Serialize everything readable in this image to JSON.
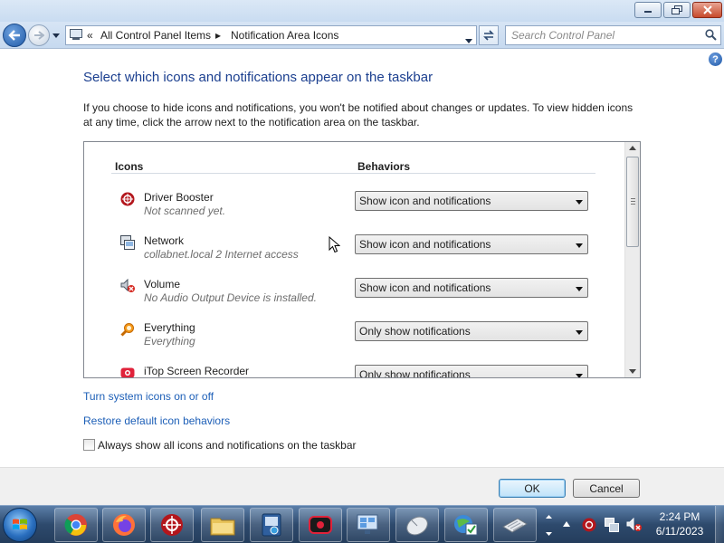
{
  "window": {
    "controls": {
      "minimize_icon": "minimize-icon",
      "maximize_icon": "maximize-icon",
      "close_icon": "close-icon"
    }
  },
  "address_bar": {
    "overflow_chevron": "«",
    "breadcrumbs": [
      "All Control Panel Items",
      "Notification Area Icons"
    ],
    "separator": "▸",
    "search_placeholder": "Search Control Panel"
  },
  "page": {
    "heading": "Select which icons and notifications appear on the taskbar",
    "description": "If you choose to hide icons and notifications, you won't be notified about changes or updates. To view hidden icons at any time, click the arrow next to the notification area on the taskbar.",
    "columns": {
      "icons": "Icons",
      "behaviors": "Behaviors"
    },
    "items": [
      {
        "name": "Driver Booster",
        "detail": "Not scanned yet.",
        "behavior": "Show icon and notifications",
        "icon": "driver-booster-icon"
      },
      {
        "name": "Network",
        "detail": "collabnet.local  2 Internet access",
        "behavior": "Show icon and notifications",
        "icon": "network-icon"
      },
      {
        "name": "Volume",
        "detail": "No Audio Output Device is installed.",
        "behavior": "Show icon and notifications",
        "icon": "volume-icon"
      },
      {
        "name": "Everything",
        "detail": "Everything",
        "behavior": "Only show notifications",
        "icon": "everything-search-icon"
      },
      {
        "name": "iTop Screen Recorder",
        "detail": "",
        "behavior": "Only show notifications",
        "icon": "itop-recorder-icon"
      }
    ],
    "links": {
      "system_icons": "Turn system icons on or off",
      "restore_defaults": "Restore default icon behaviors"
    },
    "always_show_label": "Always show all icons and notifications on the taskbar",
    "always_show_checked": false
  },
  "buttons": {
    "ok": "OK",
    "cancel": "Cancel"
  },
  "taskbar": {
    "pinned": [
      "chrome-icon",
      "firefox-icon",
      "driver-booster-icon",
      "file-explorer-icon",
      "control-panel-icon",
      "itop-recorder-icon",
      "network-settings-icon",
      "mouse-icon",
      "internet-settings-icon",
      "keyboard-icon"
    ],
    "tray": [
      "show-hidden-icons-arrow",
      "driver-booster-icon",
      "network-icon",
      "volume-icon"
    ],
    "time": "2:24 PM",
    "date": "6/11/2023"
  },
  "colors": {
    "heading": "#1b3f8f",
    "link": "#1d5fb7",
    "taskbar": "#2e4a6d",
    "titlebar": "#c9dcf1"
  }
}
